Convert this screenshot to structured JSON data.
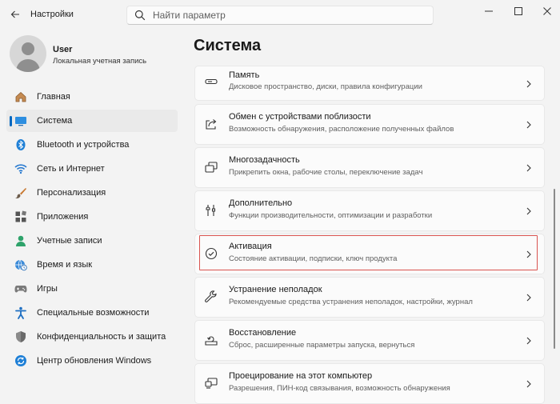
{
  "app": {
    "title": "Настройки"
  },
  "search": {
    "placeholder": "Найти параметр"
  },
  "profile": {
    "name": "User",
    "account_type": "Локальная учетная запись"
  },
  "sidebar": {
    "items": [
      {
        "label": "Главная",
        "icon": "home-icon"
      },
      {
        "label": "Система",
        "icon": "monitor-icon",
        "active": true
      },
      {
        "label": "Bluetooth и устройства",
        "icon": "bluetooth-icon"
      },
      {
        "label": "Сеть и Интернет",
        "icon": "wifi-icon"
      },
      {
        "label": "Персонализация",
        "icon": "brush-icon"
      },
      {
        "label": "Приложения",
        "icon": "apps-icon"
      },
      {
        "label": "Учетные записи",
        "icon": "person-icon"
      },
      {
        "label": "Время и язык",
        "icon": "globe-clock-icon"
      },
      {
        "label": "Игры",
        "icon": "gamepad-icon"
      },
      {
        "label": "Специальные возможности",
        "icon": "accessibility-icon"
      },
      {
        "label": "Конфиденциальность и защита",
        "icon": "shield-icon"
      },
      {
        "label": "Центр обновления Windows",
        "icon": "update-icon"
      }
    ]
  },
  "main": {
    "title": "Система",
    "cards": [
      {
        "title": "Память",
        "subtitle": "Дисковое пространство, диски, правила конфигурации",
        "icon": "storage-icon"
      },
      {
        "title": "Обмен с устройствами поблизости",
        "subtitle": "Возможность обнаружения, расположение полученных файлов",
        "icon": "share-icon"
      },
      {
        "title": "Многозадачность",
        "subtitle": "Прикрепить окна, рабочие столы, переключение задач",
        "icon": "multitask-icon"
      },
      {
        "title": "Дополнительно",
        "subtitle": "Функции производительности, оптимизации и разработки",
        "icon": "tools-icon"
      },
      {
        "title": "Активация",
        "subtitle": "Состояние активации, подписки, ключ продукта",
        "icon": "check-circle-icon",
        "highlighted": true
      },
      {
        "title": "Устранение неполадок",
        "subtitle": "Рекомендуемые средства устранения неполадок, настройки, журнал",
        "icon": "wrench-icon"
      },
      {
        "title": "Восстановление",
        "subtitle": "Сброс, расширенные параметры запуска, вернуться",
        "icon": "recovery-icon"
      },
      {
        "title": "Проецирование на этот компьютер",
        "subtitle": "Разрешения, ПИН-код связывания, возможность обнаружения",
        "icon": "project-icon"
      }
    ]
  },
  "colors": {
    "accent": "#0067c0",
    "highlight_border": "#d9534f"
  }
}
